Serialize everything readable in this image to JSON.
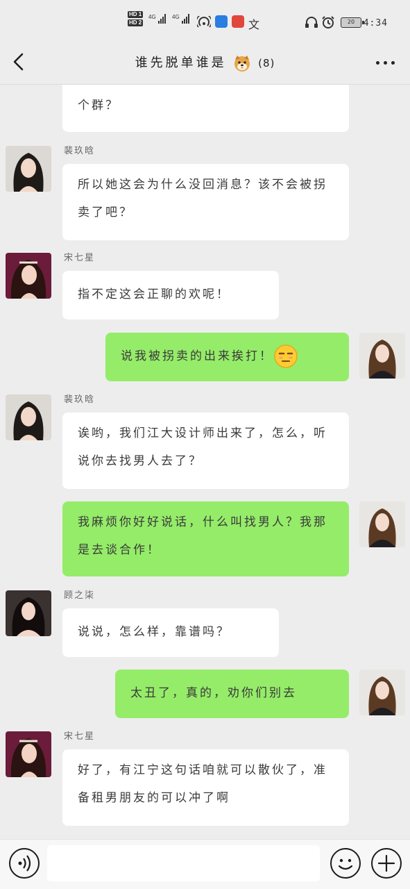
{
  "status_bar": {
    "hd1": "HD 1",
    "hd2": "HD 2",
    "net1": "4G",
    "net2": "4G",
    "ime": "文",
    "battery": "20",
    "time": "4:34"
  },
  "header": {
    "title": "谁先脱单谁是",
    "member_count": "(8)"
  },
  "messages": [
    {
      "side": "in",
      "sender": "",
      "text": "个群？"
    },
    {
      "side": "in",
      "sender": "裴玖晗",
      "text": "所以她这会为什么没回消息？该不会被拐卖了吧？"
    },
    {
      "side": "in",
      "sender": "宋七星",
      "text": "指不定这会正聊的欢呢！"
    },
    {
      "side": "out",
      "sender": "",
      "text": "说我被拐卖的出来挨打！"
    },
    {
      "side": "in",
      "sender": "裴玖晗",
      "text": "诶哟，我们江大设计师出来了，怎么，听说你去找男人去了？"
    },
    {
      "side": "out",
      "sender": "",
      "text": "我麻烦你好好说话，什么叫找男人？我那是去谈合作！"
    },
    {
      "side": "in",
      "sender": "顾之柒",
      "text": "说说，怎么样，靠谱吗？"
    },
    {
      "side": "out",
      "sender": "",
      "text": "太丑了，真的，劝你们别去"
    },
    {
      "side": "in",
      "sender": "宋七星",
      "text": "好了，有江宁这句话咱就可以散伙了，准备租男朋友的可以冲了啊"
    }
  ],
  "colors": {
    "background": "#ededed",
    "bubble_in": "#ffffff",
    "bubble_out": "#95ec69"
  }
}
